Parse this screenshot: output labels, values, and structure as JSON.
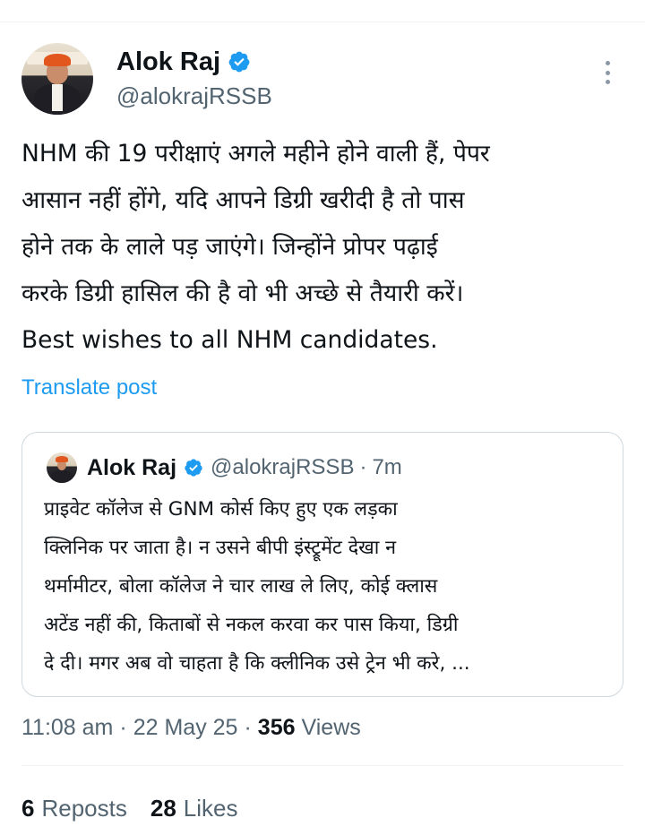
{
  "post": {
    "author": {
      "display_name": "Alok Raj",
      "handle": "@alokrajRSSB",
      "verified_icon": "verified-badge-icon",
      "verified_color": "#1d9bf0"
    },
    "text_lines": [
      "NHM की 19 परीक्षाएं अगले महीने होने वाली हैं, पेपर",
      "आसान नहीं होंगे, यदि आपने डिग्री खरीदी है तो पास",
      "होने तक के लाले पड़ जाएंगे। जिन्होंने प्रोपर पढ़ाई",
      "करके डिग्री हासिल की है वो भी अच्छे से तैयारी करें।",
      "Best wishes to all NHM candidates."
    ],
    "translate_label": "Translate post",
    "time": "11:08 am",
    "date": "22 May 25",
    "views_count": "356",
    "views_label": "Views",
    "reposts_count": "6",
    "reposts_label": "Reposts",
    "likes_count": "28",
    "likes_label": "Likes"
  },
  "quoted": {
    "display_name": "Alok Raj",
    "handle": "@alokrajRSSB",
    "separator": "·",
    "time_ago": "7m",
    "text_lines": [
      "प्राइवेट कॉलेज से GNM कोर्स किए हुए एक लड़का",
      "क्लिनिक पर जाता है। न उसने बीपी इंस्ट्रूमेंट देखा न",
      "थर्मामीटर,  बोला कॉलेज ने चार लाख ले लिए, कोई क्लास",
      "अटेंड नहीं की, किताबों से नकल करवा कर पास किया, डिग्री",
      "दे दी। मगर अब वो चाहता है कि क्लीनिक उसे ट्रेन भी करे, ..."
    ]
  },
  "meta_separator": "·",
  "colors": {
    "text_primary": "#0f1419",
    "text_secondary": "#536471",
    "link": "#1d9bf0",
    "border": "#cfd9de"
  }
}
